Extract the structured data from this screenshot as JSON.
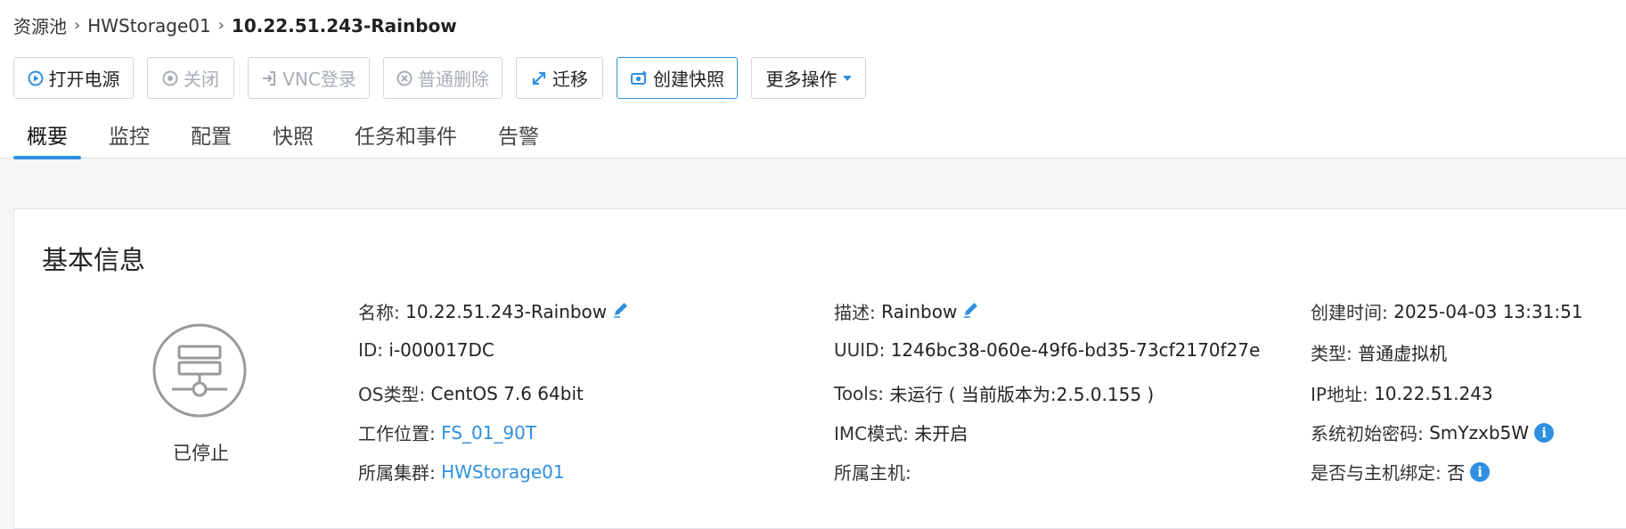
{
  "breadcrumb": {
    "items": [
      "资源池",
      "HWStorage01"
    ],
    "current": "10.22.51.243-Rainbow"
  },
  "toolbar": {
    "power_on": "打开电源",
    "shutdown": "关闭",
    "vnc_login": "VNC登录",
    "delete": "普通删除",
    "migrate": "迁移",
    "create_snapshot": "创建快照",
    "more_actions": "更多操作"
  },
  "tabs": [
    "概要",
    "监控",
    "配置",
    "快照",
    "任务和事件",
    "告警"
  ],
  "basic_info": {
    "title": "基本信息",
    "status": "已停止",
    "col1": {
      "name_label": "名称:",
      "name_value": "10.22.51.243-Rainbow",
      "id_label": "ID:",
      "id_value": "i-000017DC",
      "os_label": "OS类型:",
      "os_value": "CentOS 7.6 64bit",
      "location_label": "工作位置:",
      "location_value": "FS_01_90T",
      "cluster_label": "所属集群:",
      "cluster_value": "HWStorage01"
    },
    "col2": {
      "desc_label": "描述:",
      "desc_value": "Rainbow",
      "uuid_label": "UUID:",
      "uuid_value": "1246bc38-060e-49f6-bd35-73cf2170f27e",
      "tools_label": "Tools:",
      "tools_value": "未运行 ( 当前版本为:2.5.0.155 )",
      "imc_label": "IMC模式:",
      "imc_value": "未开启",
      "host_label": "所属主机:",
      "host_value": ""
    },
    "col3": {
      "created_label": "创建时间:",
      "created_value": "2025-04-03 13:31:51",
      "type_label": "类型:",
      "type_value": "普通虚拟机",
      "ip_label": "IP地址:",
      "ip_value": "10.22.51.243",
      "password_label": "系统初始密码:",
      "password_value": "SmYzxb5W",
      "bind_label": "是否与主机绑定:",
      "bind_value": "否"
    }
  },
  "colors": {
    "accent": "#2f8fe0",
    "disabled": "#a8adb3"
  },
  "icons": [
    "play-icon",
    "power-off-icon",
    "login-icon",
    "delete-icon",
    "migrate-icon",
    "snapshot-icon",
    "caret-down-icon",
    "pencil-icon",
    "info-icon",
    "server-icon"
  ]
}
